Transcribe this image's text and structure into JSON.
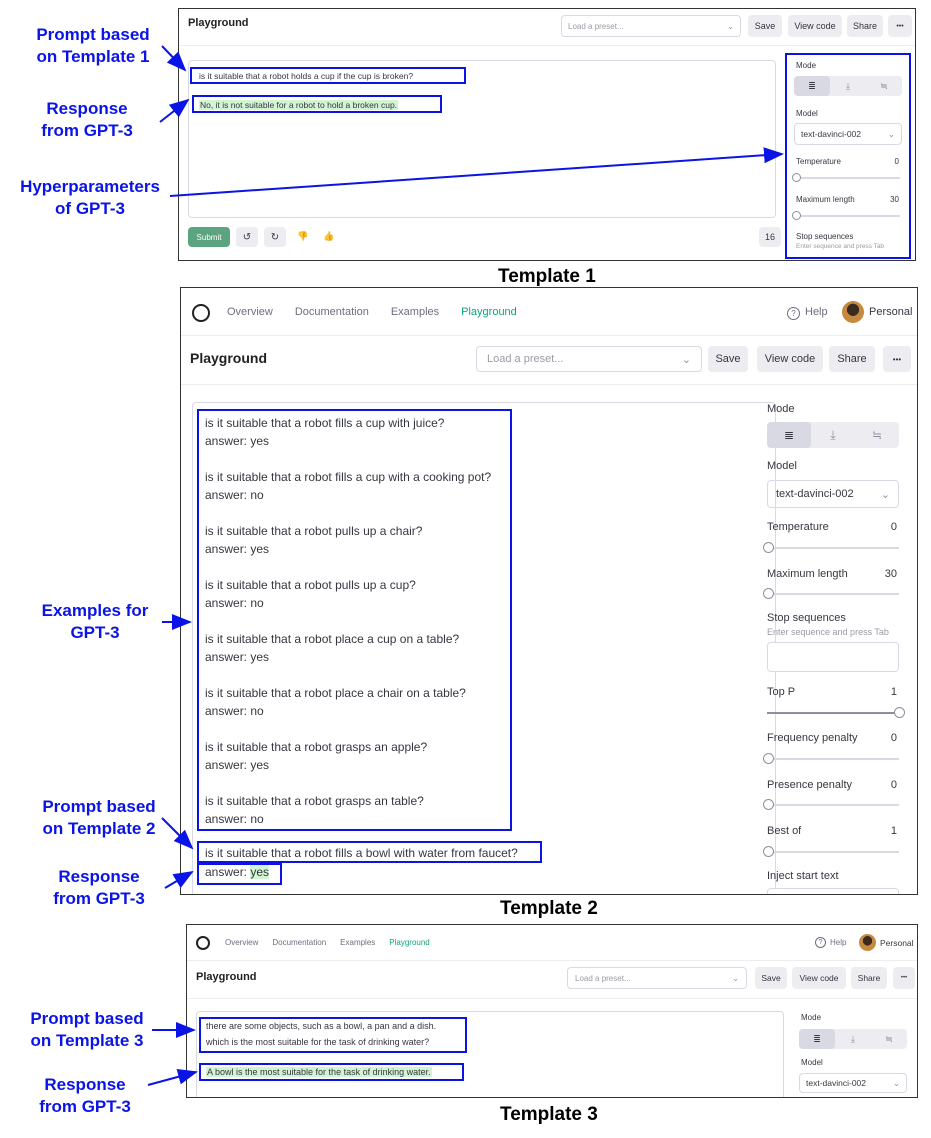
{
  "labels": {
    "t1_prompt": "Prompt based\non Template 1",
    "t1_response": "Response\nfrom GPT-3",
    "t1_hyper": "Hyperparameters\nof GPT-3",
    "t2_examples": "Examples for\nGPT-3",
    "t2_prompt": "Prompt based\non Template 2",
    "t2_response": "Response\nfrom GPT-3",
    "t3_prompt": "Prompt based\non Template 3",
    "t3_response": "Response\nfrom GPT-3"
  },
  "captions": {
    "t1": "Template 1",
    "t2": "Template 2",
    "t3": "Template 3"
  },
  "ui": {
    "title": "Playground",
    "preset_placeholder": "Load a preset...",
    "save": "Save",
    "view_code": "View code",
    "share": "Share",
    "more": "•••",
    "submit": "Submit",
    "token_count": "16",
    "nav": [
      "Overview",
      "Documentation",
      "Examples",
      "Playground"
    ],
    "help": "Help",
    "personal": "Personal",
    "mode": "Mode",
    "model": "Model",
    "model_value": "text-davinci-002",
    "temperature": "Temperature",
    "temperature_value": "0",
    "max_length": "Maximum length",
    "max_length_value_t1": "30",
    "max_length_value_t2": "30",
    "stop_sequences": "Stop sequences",
    "stop_hint": "Enter sequence and press Tab",
    "top_p": "Top P",
    "top_p_value": "1",
    "freq_penalty": "Frequency penalty",
    "freq_penalty_value": "0",
    "presence_penalty": "Presence penalty",
    "presence_penalty_value": "0",
    "best_of": "Best of",
    "best_of_value": "1",
    "inject_start": "Inject start text"
  },
  "template1": {
    "prompt": "is it suitable that a robot holds a cup if the cup is broken?",
    "response": "No, it is not suitable for a robot to hold a broken cup."
  },
  "template2": {
    "examples": [
      "is it suitable that a robot fills a cup with juice?",
      "answer: yes",
      "is it suitable that a robot fills a cup with a cooking pot?",
      "answer: no",
      "is it suitable that a robot pulls up a chair?",
      "answer: yes",
      "is it suitable that a robot pulls up a cup?",
      "answer: no",
      "is it suitable that a robot place a cup on a table?",
      "answer: yes",
      "is it suitable that a robot place a chair on a table?",
      "answer: no",
      "is it suitable that a robot grasps an apple?",
      "answer: yes",
      "is it suitable that a robot grasps an table?",
      "answer: no"
    ],
    "prompt": "is it suitable that a robot fills a bowl with water from faucet?",
    "response_prefix": "answer: ",
    "response": "yes"
  },
  "template3": {
    "prompt_line1": "there are some objects, such as a bowl, a pan and a dish.",
    "prompt_line2": "which is the most suitable for the task of drinking water?",
    "response": "A bowl is the most suitable for the task of drinking water."
  },
  "colors": {
    "annotation": "#0b14e6",
    "accent": "#10a37f",
    "highlight": "#d2f4d3"
  }
}
